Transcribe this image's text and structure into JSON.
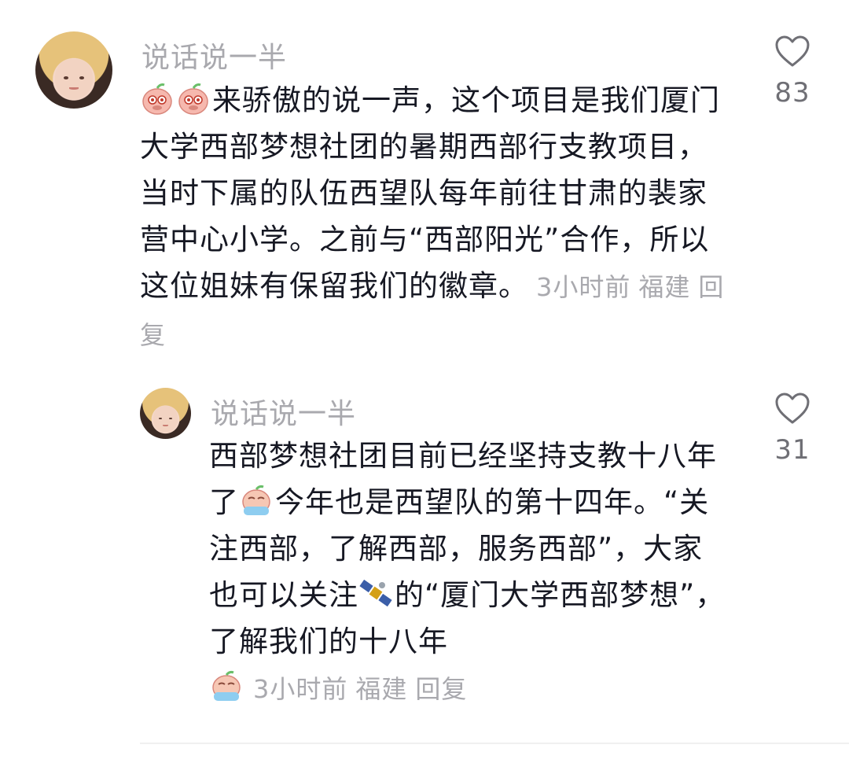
{
  "comments": [
    {
      "username": "说话说一半",
      "emoji": "crying-peach-emoji",
      "text": "来骄傲的说一声，这个项目是我们厦门大学西部梦想社团的暑期西部行支教项目，当时下属的队伍西望队每年前往甘肃的裴家营中心小学。之前与“西部阳光”合作，所以这位姐妹有保留我们的徽章。",
      "time": "3小时前",
      "location": "福建",
      "reply": "回复",
      "likes": "83"
    },
    {
      "username": "说话说一半",
      "text_1": "西部梦想社团目前已经坚持支教十八年了",
      "text_2": "今年也是西望队的第十四年。“关注西部，了解西部，服务西部”，大家也可以关注",
      "text_3": "的“厦门大学西部梦想”，了解我们的十八年",
      "time": "3小时前",
      "location": "福建",
      "reply": "回复",
      "likes": "31",
      "icons": [
        "crying-peach-emoji",
        "satellite-emoji"
      ]
    }
  ],
  "colors": {
    "text": "#161823",
    "muted": "#a9a9ae",
    "count": "#6f6f75"
  }
}
